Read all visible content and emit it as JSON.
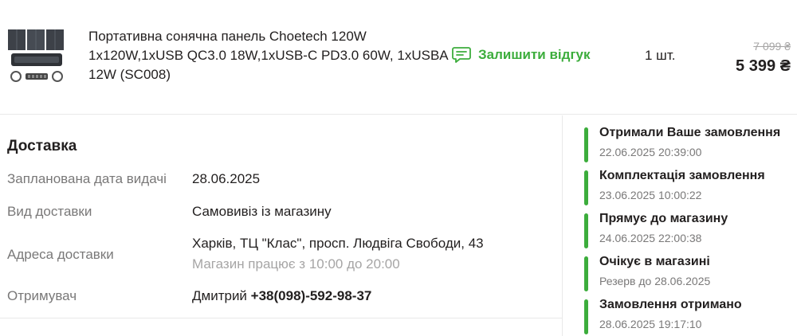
{
  "product": {
    "image_icon": "solar-panel-product-image",
    "name": "Портативна сонячна панель Choetech 120W 1x120W,1xUSB QC3.0 18W,1xUSB-C PD3.0 60W, 1xUSBA 12W (SC008)",
    "review_label": "Залишити відгук",
    "review_icon": "chat-bubble-icon",
    "quantity": "1 шт.",
    "old_price": "7 099 ₴",
    "price": "5 399 ₴",
    "accent_color": "#3cad3c"
  },
  "delivery": {
    "title": "Доставка",
    "rows": [
      {
        "label": "Запланована дата видачі",
        "value": "28.06.2025"
      },
      {
        "label": "Вид доставки",
        "value": "Самовивіз із магазину"
      },
      {
        "label": "Адреса доставки",
        "value": "Харків, ТЦ \"Клас\", просп. Людвіга Свободи, 43",
        "note": "Магазин працює з 10:00 до 20:00"
      },
      {
        "label": "Отримувач",
        "value_name": "Дмитрий",
        "value_phone": "+38(098)-592-98-37"
      }
    ]
  },
  "timeline": [
    {
      "title": "Отримали Ваше замовлення",
      "time": "22.06.2025 20:39:00"
    },
    {
      "title": "Комплектація замовлення",
      "time": "23.06.2025 10:00:22"
    },
    {
      "title": "Прямує до магазину",
      "time": "24.06.2025 22:00:38"
    },
    {
      "title": "Очікує в магазині",
      "time": "Резерв до 28.06.2025"
    },
    {
      "title": "Замовлення отримано",
      "time": "28.06.2025 19:17:10"
    }
  ]
}
